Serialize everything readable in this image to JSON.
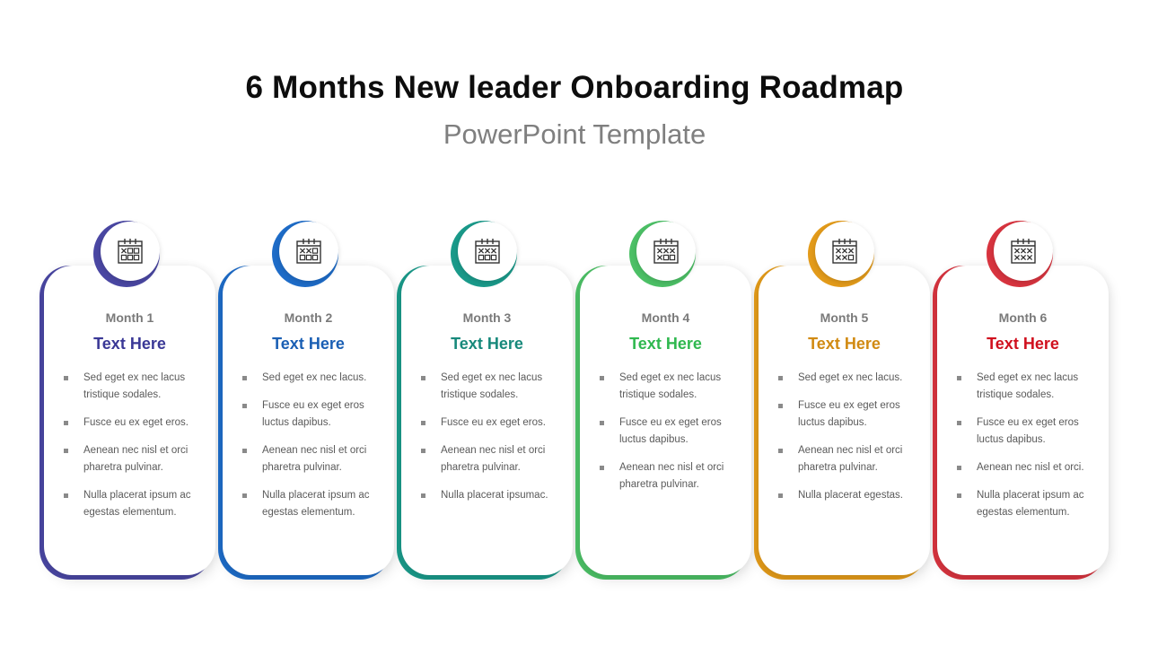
{
  "header": {
    "title": "6 Months New leader Onboarding Roadmap",
    "subtitle": "PowerPoint Template"
  },
  "months": [
    {
      "label": "Month 1",
      "heading": "Text Here",
      "color": "#4a47a3",
      "heading_color": "#3a3896",
      "icon": "calendar-icon",
      "calendar_marks": [
        "x",
        "o",
        "o",
        "o",
        "o",
        "o"
      ],
      "bullets": [
        "Sed eget ex nec lacus tristique sodales.",
        "Fusce eu ex eget eros.",
        "Aenean nec nisl et orci pharetra pulvinar.",
        "Nulla placerat ipsum ac egestas elementum."
      ]
    },
    {
      "label": "Month 2",
      "heading": "Text Here",
      "color": "#1e6cc8",
      "heading_color": "#1a5fb4",
      "icon": "calendar-icon",
      "calendar_marks": [
        "x",
        "x",
        "o",
        "o",
        "o",
        "o"
      ],
      "bullets": [
        "Sed eget ex nec lacus.",
        "Fusce eu ex eget eros luctus dapibus.",
        "Aenean nec nisl et orci pharetra pulvinar.",
        "Nulla placerat ipsum ac egestas elementum."
      ]
    },
    {
      "label": "Month 3",
      "heading": "Text Here",
      "color": "#1a9a8a",
      "heading_color": "#17897b",
      "icon": "calendar-icon",
      "calendar_marks": [
        "x",
        "x",
        "x",
        "o",
        "o",
        "o"
      ],
      "bullets": [
        "Sed eget ex nec lacus tristique sodales.",
        "Fusce eu ex eget eros.",
        "Aenean nec nisl et orci pharetra pulvinar.",
        "Nulla placerat ipsumac."
      ]
    },
    {
      "label": "Month 4",
      "heading": "Text Here",
      "color": "#4cc066",
      "heading_color": "#2fb84f",
      "icon": "calendar-icon",
      "calendar_marks": [
        "x",
        "x",
        "x",
        "x",
        "o",
        "o"
      ],
      "bullets": [
        "Sed eget ex nec lacus tristique sodales.",
        "Fusce eu ex eget eros luctus dapibus.",
        "Aenean nec nisl et orci pharetra pulvinar."
      ]
    },
    {
      "label": "Month 5",
      "heading": "Text Here",
      "color": "#e39b1a",
      "heading_color": "#d18a12",
      "icon": "calendar-icon",
      "calendar_marks": [
        "x",
        "x",
        "x",
        "x",
        "x",
        "o"
      ],
      "bullets": [
        "Sed eget ex nec lacus.",
        "Fusce eu ex eget eros luctus dapibus.",
        "Aenean nec nisl et orci pharetra pulvinar.",
        "Nulla placerat egestas."
      ]
    },
    {
      "label": "Month 6",
      "heading": "Text Here",
      "color": "#d8343f",
      "heading_color": "#d0101e",
      "icon": "calendar-icon",
      "calendar_marks": [
        "x",
        "x",
        "x",
        "x",
        "x",
        "x"
      ],
      "bullets": [
        "Sed eget ex nec lacus tristique sodales.",
        "Fusce eu ex eget eros luctus dapibus.",
        "Aenean nec nisl et orci.",
        "Nulla placerat ipsum ac egestas elementum."
      ]
    }
  ]
}
